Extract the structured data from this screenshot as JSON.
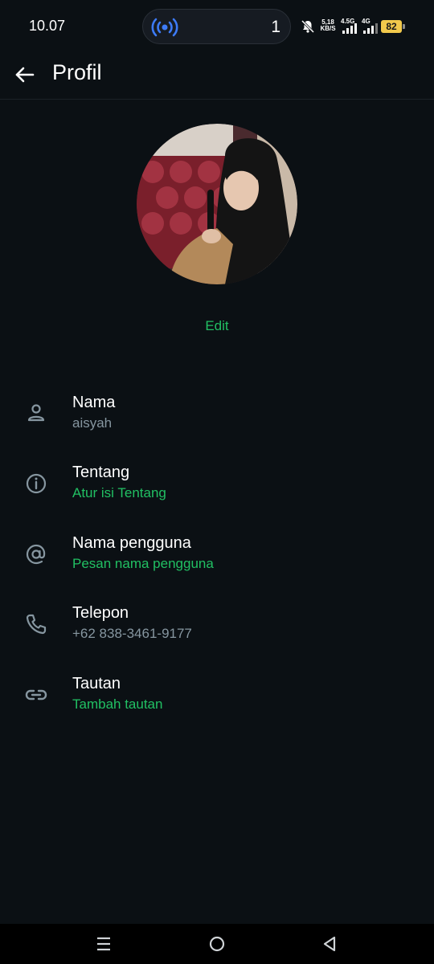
{
  "status_bar": {
    "time": "10.07",
    "notification_count": "1",
    "net_speed_value": "5,18",
    "net_speed_unit": "KB/S",
    "signal1_label": "4.5G",
    "signal2_label": "4G",
    "battery": "82",
    "accent": "#3d7bf7"
  },
  "app_bar": {
    "title": "Profil",
    "back_icon": "arrow-left-icon"
  },
  "profile": {
    "edit_label": "Edit",
    "accent_color": "#21c063"
  },
  "info_items": [
    {
      "icon": "person-icon",
      "label": "Nama",
      "value": "aisyah",
      "accent": false
    },
    {
      "icon": "info-icon",
      "label": "Tentang",
      "value": "Atur isi Tentang",
      "accent": true
    },
    {
      "icon": "at-icon",
      "label": "Nama pengguna",
      "value": "Pesan nama pengguna",
      "accent": true
    },
    {
      "icon": "phone-icon",
      "label": "Telepon",
      "value": "+62 838-3461-9177",
      "accent": false
    },
    {
      "icon": "link-icon",
      "label": "Tautan",
      "value": "Tambah tautan",
      "accent": true
    }
  ],
  "nav_bar": {
    "menu_icon": "recent-apps-icon",
    "home_icon": "home-icon",
    "back_icon": "back-triangle-icon"
  }
}
